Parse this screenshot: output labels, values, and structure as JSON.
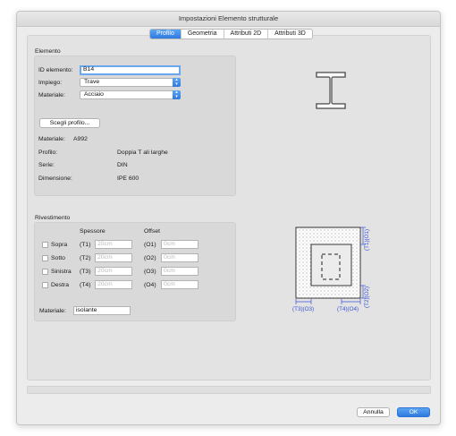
{
  "window": {
    "title": "Impostazioni Elemento strutturale"
  },
  "tabs": [
    {
      "label": "Profilo",
      "active": true
    },
    {
      "label": "Geometria",
      "active": false
    },
    {
      "label": "Attributi 2D",
      "active": false
    },
    {
      "label": "Attributi 3D",
      "active": false
    }
  ],
  "elemento": {
    "section_title": "Elemento",
    "id_label": "ID elemento:",
    "id_value": "B14",
    "impiego_label": "Impiego:",
    "impiego_value": "Trave",
    "materiale_label": "Materiale:",
    "materiale_value": "Acciaio",
    "scegli_button": "Scegli profilo...",
    "info": [
      {
        "label": "Materiale:",
        "value": "A992"
      },
      {
        "label": "Profilo:",
        "value": "Doppia T ali larghe"
      },
      {
        "label": "Serie:",
        "value": "DIN"
      },
      {
        "label": "Dimensione:",
        "value": "IPE 600"
      }
    ]
  },
  "rivestimento": {
    "section_title": "Rivestimento",
    "col_spessore": "Spessore",
    "col_offset": "Offset",
    "rows": [
      {
        "side": "Sopra",
        "t": "(T1)",
        "t_placeholder": "20cm",
        "o": "(O1)",
        "o_placeholder": "0cm"
      },
      {
        "side": "Sotto",
        "t": "(T2)",
        "t_placeholder": "20cm",
        "o": "(O2)",
        "o_placeholder": "0cm"
      },
      {
        "side": "Sinistra",
        "t": "(T3)",
        "t_placeholder": "20cm",
        "o": "(O3)",
        "o_placeholder": "0cm"
      },
      {
        "side": "Destra",
        "t": "(T4)",
        "t_placeholder": "20cm",
        "o": "(O4)",
        "o_placeholder": "0cm"
      }
    ],
    "materiale_label": "Materiale:",
    "materiale_value": "isolante"
  },
  "diagram": {
    "labels": {
      "t1o1": "(T1)(O1)",
      "t2o2": "(T2)(O2)",
      "t3o3": "(T3)(O3)",
      "t4o4": "(T4)(O4)"
    }
  },
  "footer": {
    "cancel_label": "Annulla",
    "ok_label": "OK"
  },
  "colors": {
    "accent": "#2f7ae0",
    "dimension": "#3b54d4",
    "focus": "#6aa7ef"
  }
}
